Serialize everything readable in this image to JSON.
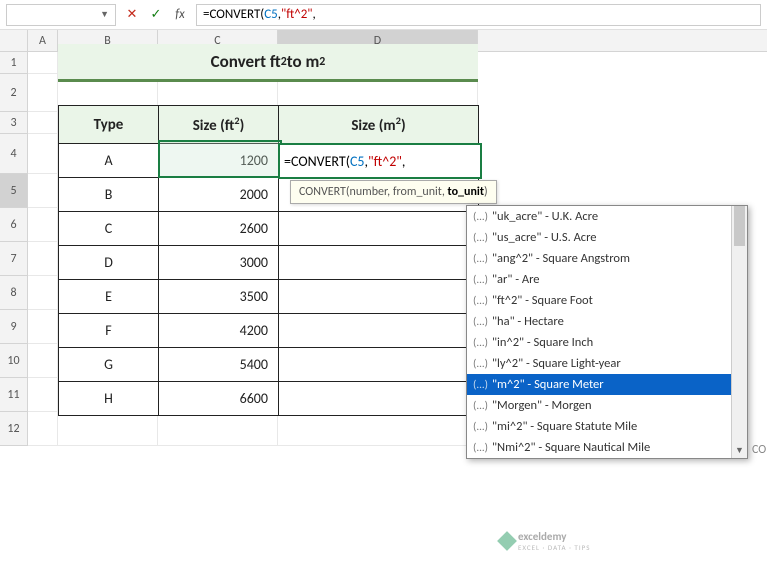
{
  "formula_bar": {
    "name_box": "",
    "cancel": "✕",
    "enter": "✓",
    "fx": "fx",
    "formula_prefix": "=CONVERT(",
    "formula_ref": "C5",
    "formula_sep1": ",",
    "formula_str": "\"ft^2\"",
    "formula_sep2": ","
  },
  "cols": {
    "A": "A",
    "B": "B",
    "C": "C",
    "D": "D"
  },
  "rows": {
    "1": "1",
    "2": "2",
    "3": "3",
    "4": "4",
    "5": "5",
    "6": "6",
    "7": "7",
    "8": "8",
    "9": "9",
    "10": "10",
    "11": "11",
    "12": "12"
  },
  "title": {
    "pre": "Convert ft",
    "sup1": "2",
    "mid": " to m",
    "sup2": "2"
  },
  "headers": {
    "type": "Type",
    "size_ft_pre": "Size (ft",
    "size_ft_sup": "2",
    "size_ft_post": ")",
    "size_m_pre": "Size (m",
    "size_m_sup": "2",
    "size_m_post": ")"
  },
  "data": [
    {
      "type": "A",
      "size": "1200"
    },
    {
      "type": "B",
      "size": "2000"
    },
    {
      "type": "C",
      "size": "2600"
    },
    {
      "type": "D",
      "size": "3000"
    },
    {
      "type": "E",
      "size": "3500"
    },
    {
      "type": "F",
      "size": "4200"
    },
    {
      "type": "G",
      "size": "5400"
    },
    {
      "type": "H",
      "size": "6600"
    }
  ],
  "tooltip": {
    "fn": "CONVERT(",
    "a1": "number",
    "s1": ", ",
    "a2": "from_unit",
    "s2": ", ",
    "a3": "to_unit",
    "end": ")"
  },
  "dropdown": [
    {
      "t": "\"uk_acre\" - U.K. Acre"
    },
    {
      "t": "\"us_acre\" - U.S. Acre"
    },
    {
      "t": "\"ang^2\" - Square Angstrom"
    },
    {
      "t": "\"ar\" - Are"
    },
    {
      "t": "\"ft^2\" - Square Foot"
    },
    {
      "t": "\"ha\" - Hectare"
    },
    {
      "t": "\"in^2\" - Square Inch"
    },
    {
      "t": "\"ly^2\" - Square Light-year"
    },
    {
      "t": "\"m^2\" - Square Meter"
    },
    {
      "t": "\"Morgen\" - Morgen"
    },
    {
      "t": "\"mi^2\" - Square Statute Mile"
    },
    {
      "t": "\"Nmi^2\" - Square Nautical Mile"
    }
  ],
  "dropdown_selected_index": 8,
  "co_hint": "CO",
  "watermark": {
    "name": "exceldemy",
    "tag": "EXCEL · DATA · TIPS"
  }
}
